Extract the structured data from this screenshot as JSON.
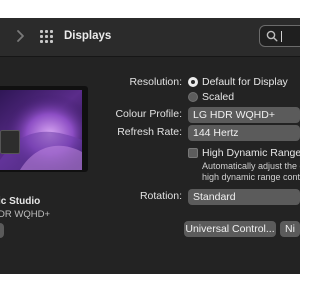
{
  "window": {
    "title": "Displays"
  },
  "icons": {
    "forward": "chevron-right-icon",
    "grid": "grid-icon",
    "search": "search-icon"
  },
  "monitor": {
    "name": "ic Studio",
    "model": "DR WQHD+"
  },
  "settings": {
    "resolution_label": "Resolution:",
    "resolution_options": [
      "Default for Display",
      "Scaled"
    ],
    "resolution_selected": "Default for Display",
    "colour_profile_label": "Colour Profile:",
    "colour_profile_value": "LG HDR WQHD+",
    "refresh_rate_label": "Refresh Rate:",
    "refresh_rate_value": "144 Hertz",
    "hdr_label": "High Dynamic Range",
    "hdr_checked": false,
    "hdr_desc_line1": "Automatically adjust the dis",
    "hdr_desc_line2": "high dynamic range conten",
    "rotation_label": "Rotation:",
    "rotation_value": "Standard"
  },
  "buttons": {
    "universal_control": "Universal Control...",
    "night": "Ni"
  },
  "colors": {
    "window_bg": "#232323",
    "toolbar_bg": "#2b2b2b",
    "control_bg": "#5b5b5b"
  }
}
